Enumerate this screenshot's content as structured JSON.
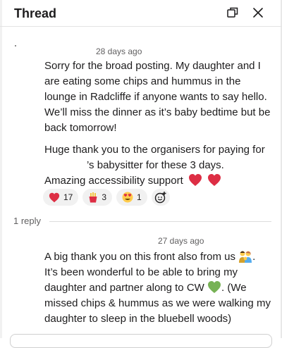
{
  "header": {
    "title": "Thread",
    "popout_icon": "popout-icon",
    "close_icon": "close-icon"
  },
  "parent_message": {
    "timestamp": "28 days ago",
    "paragraph1": "Sorry for the broad posting. My daughter and I are eating some chips and hummus in the lounge in Radcliffe if anyone wants to say hello. We’ll miss the dinner as it’s baby bedtime but be back tomorrow!",
    "paragraph2_part1": "Huge thank you to the organisers for paying for",
    "paragraph2_part2": "’s babysitter for these 3 days.",
    "paragraph2_part3": "Amazing accessibility support",
    "reactions": [
      {
        "emoji": "heart",
        "count": "17"
      },
      {
        "emoji": "fries",
        "count": "3"
      },
      {
        "emoji": "heart-eyes",
        "count": "1"
      }
    ],
    "add_reaction_icon": "add-reaction-icon"
  },
  "replies": {
    "count_label": "1 reply"
  },
  "reply_message": {
    "timestamp": "27 days ago",
    "text_part1": "A big thank you on this front also from us",
    "text_part2": ". It’s been wonderful to be able to bring my daughter and partner along to CW",
    "text_part3": ". (We missed chips & hummus as we were walking my daughter to sleep in the bluebell woods)"
  },
  "colors": {
    "text": "#1d1c1d",
    "muted": "#616061",
    "pill_bg": "#f1f1f1",
    "heart": "#dd2e44",
    "green_heart": "#77b255"
  }
}
